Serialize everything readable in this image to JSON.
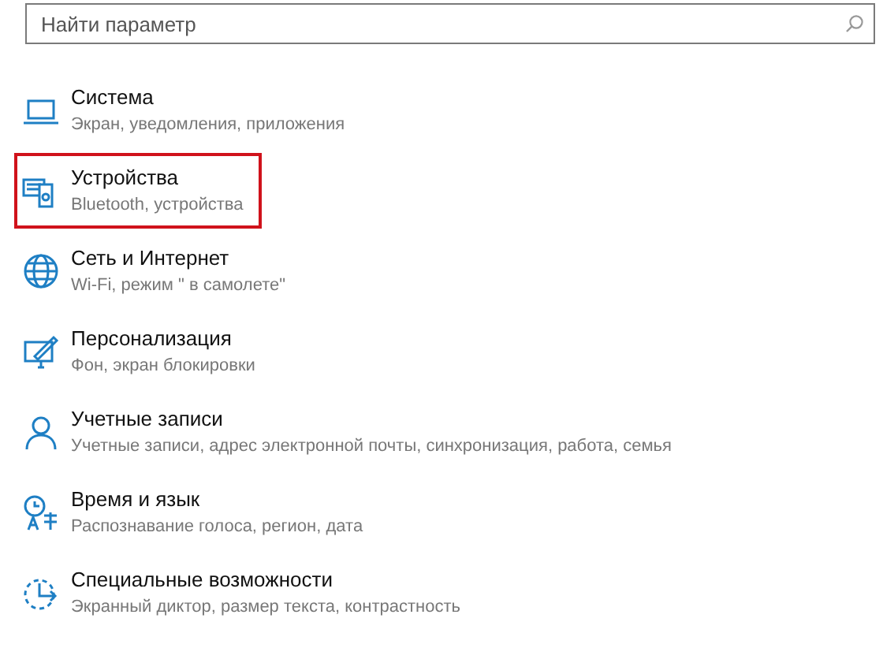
{
  "search": {
    "placeholder": "Найти параметр"
  },
  "items": [
    {
      "title": "Система",
      "subtitle": "Экран, уведомления, приложения",
      "highlighted": false
    },
    {
      "title": "Устройства",
      "subtitle": "Bluetooth, устройства",
      "highlighted": true
    },
    {
      "title": "Сеть и Интернет",
      "subtitle": "Wi-Fi, режим \" в самолете\"",
      "highlighted": false
    },
    {
      "title": "Персонализация",
      "subtitle": "Фон, экран блокировки",
      "highlighted": false
    },
    {
      "title": "Учетные записи",
      "subtitle": "Учетные записи, адрес электронной почты, синхронизация, работа, семья",
      "highlighted": false
    },
    {
      "title": "Время и язык",
      "subtitle": "Распознавание голоса, регион, дата",
      "highlighted": false
    },
    {
      "title": "Специальные возможности",
      "subtitle": "Экранный диктор, размер текста, контрастность",
      "highlighted": false
    }
  ]
}
